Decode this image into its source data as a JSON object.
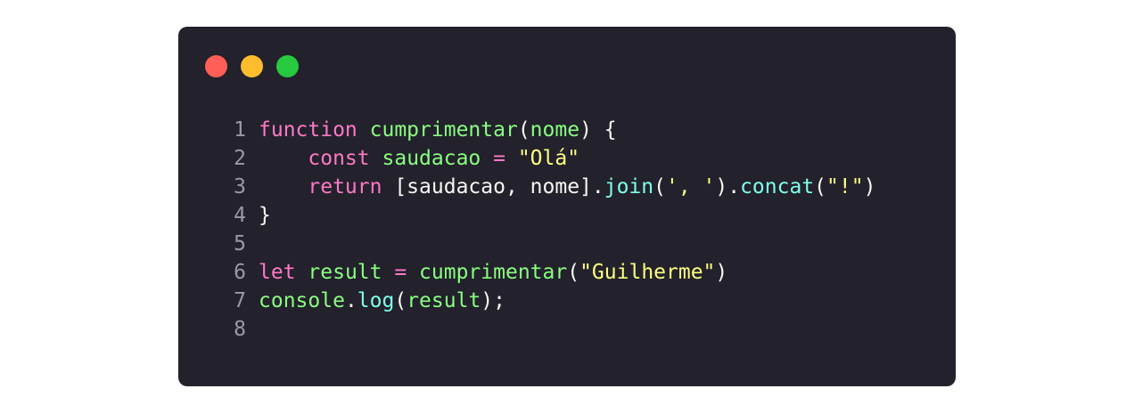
{
  "window": {
    "controls": [
      {
        "name": "close",
        "color": "#ff5f56"
      },
      {
        "name": "minimize",
        "color": "#ffbd2e"
      },
      {
        "name": "zoom",
        "color": "#27c93f"
      }
    ]
  },
  "theme": {
    "background": "#22212c",
    "keyword": "#ff79c6",
    "function": "#8aff80",
    "string": "#ffff80",
    "method": "#80ffea",
    "text": "#f8f8f2",
    "line_number": "#9a9aa6"
  },
  "code": {
    "lines": [
      {
        "number": "1",
        "tokens": [
          {
            "t": "function",
            "c": "kw"
          },
          {
            "t": " ",
            "c": "txt"
          },
          {
            "t": "cumprimentar",
            "c": "fn"
          },
          {
            "t": "(",
            "c": "txt"
          },
          {
            "t": "nome",
            "c": "fn"
          },
          {
            "t": ") {",
            "c": "txt"
          }
        ]
      },
      {
        "number": "2",
        "tokens": [
          {
            "t": "    ",
            "c": "txt"
          },
          {
            "t": "const",
            "c": "kw"
          },
          {
            "t": " ",
            "c": "txt"
          },
          {
            "t": "saudacao",
            "c": "fn"
          },
          {
            "t": " = ",
            "c": "kw"
          },
          {
            "t": "\"Olá\"",
            "c": "str"
          }
        ]
      },
      {
        "number": "3",
        "tokens": [
          {
            "t": "    ",
            "c": "txt"
          },
          {
            "t": "return",
            "c": "kw"
          },
          {
            "t": " [saudacao, nome].",
            "c": "txt"
          },
          {
            "t": "join",
            "c": "mth"
          },
          {
            "t": "(",
            "c": "txt"
          },
          {
            "t": "', '",
            "c": "str"
          },
          {
            "t": ").",
            "c": "txt"
          },
          {
            "t": "concat",
            "c": "mth"
          },
          {
            "t": "(",
            "c": "txt"
          },
          {
            "t": "\"!\"",
            "c": "str"
          },
          {
            "t": ")",
            "c": "txt"
          }
        ]
      },
      {
        "number": "4",
        "tokens": [
          {
            "t": "}",
            "c": "txt"
          }
        ]
      },
      {
        "number": "5",
        "tokens": []
      },
      {
        "number": "6",
        "tokens": [
          {
            "t": "let",
            "c": "kw"
          },
          {
            "t": " ",
            "c": "txt"
          },
          {
            "t": "result",
            "c": "fn"
          },
          {
            "t": " = ",
            "c": "kw"
          },
          {
            "t": "cumprimentar",
            "c": "fn"
          },
          {
            "t": "(",
            "c": "txt"
          },
          {
            "t": "\"Guilherme\"",
            "c": "str"
          },
          {
            "t": ")",
            "c": "txt"
          }
        ]
      },
      {
        "number": "7",
        "tokens": [
          {
            "t": "console",
            "c": "fn"
          },
          {
            "t": ".",
            "c": "txt"
          },
          {
            "t": "log",
            "c": "mth"
          },
          {
            "t": "(",
            "c": "txt"
          },
          {
            "t": "result",
            "c": "fn"
          },
          {
            "t": ");",
            "c": "txt"
          }
        ]
      },
      {
        "number": "8",
        "tokens": []
      }
    ]
  }
}
